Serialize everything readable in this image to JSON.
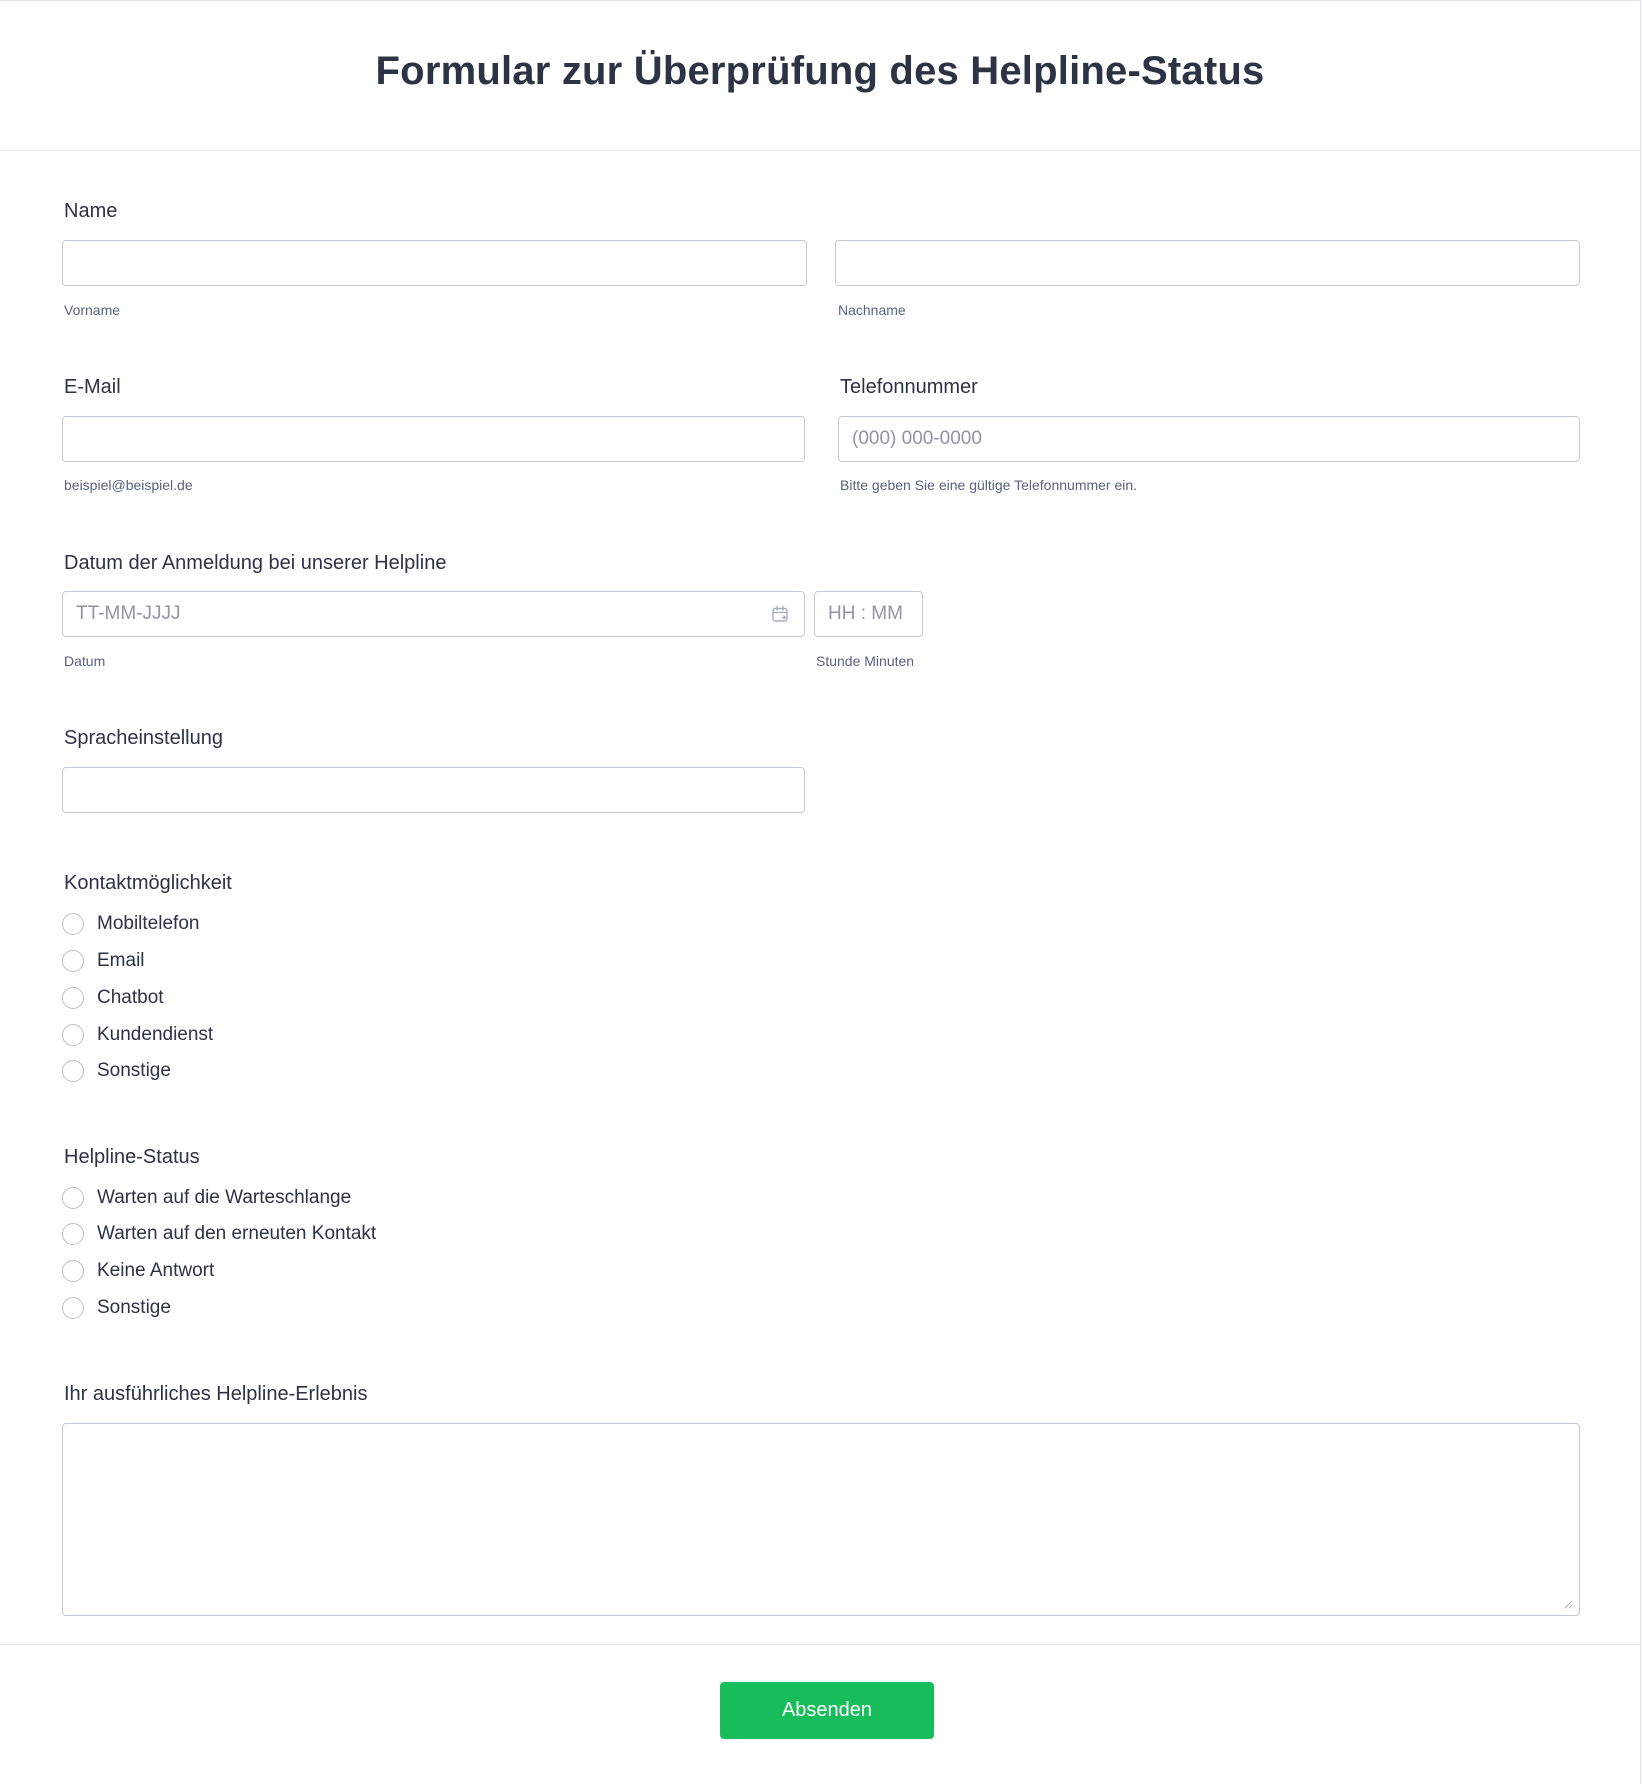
{
  "header": {
    "title": "Formular zur Überprüfung des Helpline-Status"
  },
  "name_field": {
    "label": "Name",
    "first_name_value": "",
    "first_name_sublabel": "Vorname",
    "last_name_value": "",
    "last_name_sublabel": "Nachname"
  },
  "email_field": {
    "label": "E-Mail",
    "value": "",
    "sublabel": "beispiel@beispiel.de"
  },
  "phone_field": {
    "label": "Telefonnummer",
    "value": "",
    "placeholder": "(000) 000-0000",
    "sublabel": "Bitte geben Sie eine gültige Telefonnummer ein."
  },
  "date_field": {
    "label": "Datum der Anmeldung bei unserer Helpline",
    "date_value": "",
    "date_placeholder": "TT-MM-JJJJ",
    "date_sublabel": "Datum",
    "time_value": "",
    "time_placeholder": "HH : MM",
    "time_sublabel": "Stunde Minuten",
    "calendar_icon": "calendar-icon"
  },
  "language_field": {
    "label": "Spracheinstellung",
    "value": ""
  },
  "contact_field": {
    "label": "Kontaktmöglichkeit",
    "options": [
      "Mobiltelefon",
      "Email",
      "Chatbot",
      "Kundendienst",
      "Sonstige"
    ]
  },
  "status_field": {
    "label": "Helpline-Status",
    "options": [
      "Warten auf die Warteschlange",
      "Warten auf den erneuten Kontakt",
      "Keine Antwort",
      "Sonstige"
    ]
  },
  "experience_field": {
    "label": "Ihr ausführliches Helpline-Erlebnis",
    "value": ""
  },
  "footer": {
    "submit_label": "Absenden"
  },
  "colors": {
    "accent": "#18bd5b",
    "text": "#2c3345",
    "sublabel": "#57647e",
    "border": "#c3cad8"
  }
}
